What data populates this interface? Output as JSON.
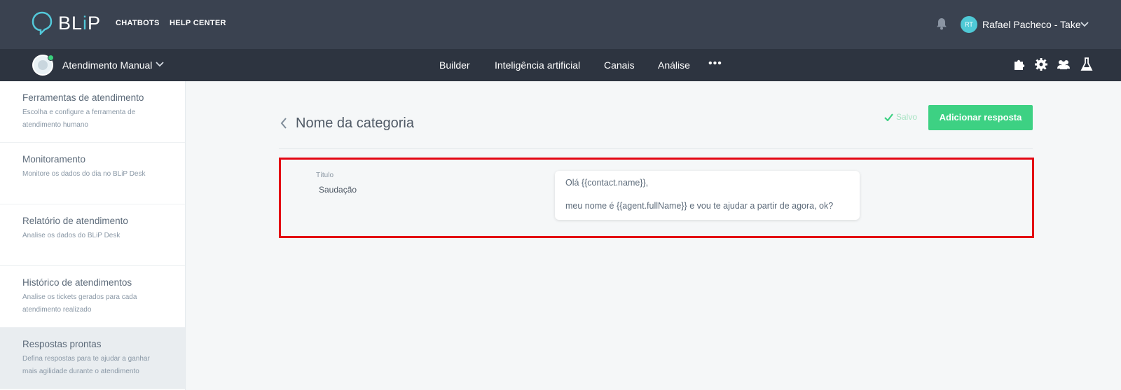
{
  "brand": {
    "name_part1": "BL",
    "name_i": "i",
    "name_part2": "P"
  },
  "topnav": {
    "chatbots": "CHATBOTS",
    "help_center": "HELP CENTER"
  },
  "user": {
    "initials": "RT",
    "name": "Rafael Pacheco - Take"
  },
  "bot": {
    "name": "Atendimento Manual"
  },
  "mainnav": {
    "items": [
      "Builder",
      "Inteligência artificial",
      "Canais",
      "Análise"
    ],
    "more": "•••"
  },
  "sidebar": {
    "items": [
      {
        "title": "Ferramentas de atendimento",
        "desc": "Escolha e configure a ferramenta de atendimento humano"
      },
      {
        "title": "Monitoramento",
        "desc": "Monitore os dados do dia no BLiP Desk"
      },
      {
        "title": "Relatório de atendimento",
        "desc": "Analise os dados do BLiP Desk"
      },
      {
        "title": "Histórico de atendimentos",
        "desc": "Analise os tickets gerados para cada atendimento realizado"
      },
      {
        "title": "Respostas prontas",
        "desc": "Defina respostas para te ajudar a ganhar mais agilidade durante o atendimento"
      }
    ]
  },
  "page": {
    "title": "Nome da categoria",
    "saved_label": "Salvo",
    "add_button": "Adicionar resposta"
  },
  "response": {
    "title_label": "Título",
    "title_value": "Saudação",
    "message_line1": "Olá {{contact.name}},",
    "message_line2": "meu nome é {{agent.fullName}} e vou te ajudar a partir de agora, ok?"
  },
  "colors": {
    "topbar": "#3a4250",
    "subbar": "#2d3440",
    "accent": "#53c8d9",
    "primary_button": "#3dd183",
    "highlight": "#e30613"
  }
}
